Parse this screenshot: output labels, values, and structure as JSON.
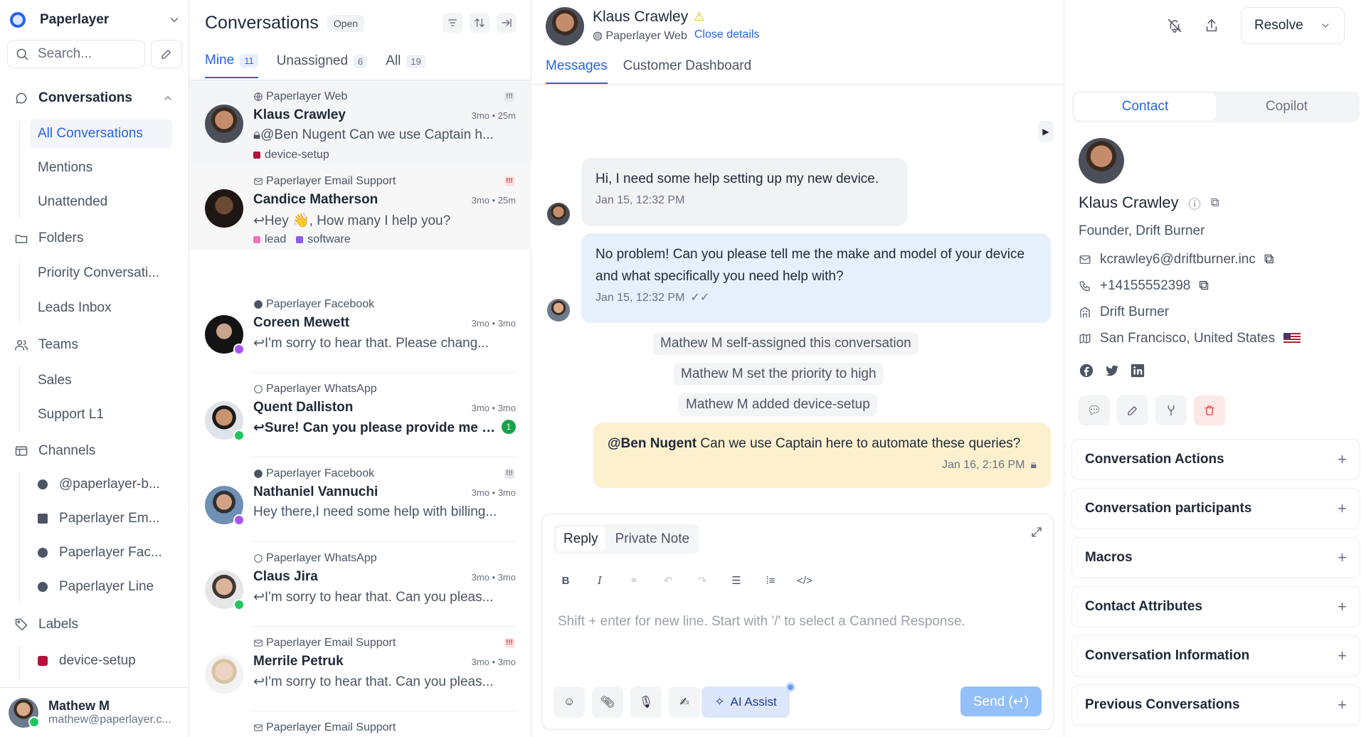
{
  "sidebar": {
    "workspace": "Paperlayer",
    "search_placeholder": "Search...",
    "groups": {
      "conversations": "Conversations",
      "folders": "Folders",
      "teams": "Teams",
      "channels": "Channels",
      "labels": "Labels"
    },
    "conversation_items": [
      "All Conversations",
      "Mentions",
      "Unattended"
    ],
    "folder_items": [
      "Priority Conversati...",
      "Leads Inbox"
    ],
    "team_items": [
      "Sales",
      "Support L1"
    ],
    "channel_items": [
      "@paperlayer-b...",
      "Paperlayer Em...",
      "Paperlayer Fac...",
      "Paperlayer Line"
    ],
    "label_items": [
      "device-setup"
    ],
    "user": {
      "name": "Mathew M",
      "email": "mathew@paperlayer.c..."
    }
  },
  "list": {
    "title": "Conversations",
    "status": "Open",
    "tabs": [
      {
        "label": "Mine",
        "count": "11"
      },
      {
        "label": "Unassigned",
        "count": "6"
      },
      {
        "label": "All",
        "count": "19"
      }
    ],
    "items": [
      {
        "channel": "Paperlayer Web",
        "name": "Klaus Crawley",
        "time": "3mo • 25m",
        "message": "@Ben Nugent Can we use Captain h...",
        "labels": [
          "device-setup"
        ]
      },
      {
        "channel": "Paperlayer Email Support",
        "name": "Candice Matherson",
        "time": "3mo • 25m",
        "message": "Hey 👋, How many I help you?",
        "labels": [
          "lead",
          "software"
        ]
      },
      {
        "channel": "Paperlayer Facebook",
        "name": "Coreen Mewett",
        "time": "3mo • 3mo",
        "message": "I'm sorry to hear that. Please chang..."
      },
      {
        "channel": "Paperlayer WhatsApp",
        "name": "Quent Dalliston",
        "time": "3mo • 3mo",
        "message": "Sure! Can you please provide me wi...",
        "unread": "1"
      },
      {
        "channel": "Paperlayer Facebook",
        "name": "Nathaniel Vannuchi",
        "time": "3mo • 3mo",
        "message": "Hey there,I need some help with billing..."
      },
      {
        "channel": "Paperlayer WhatsApp",
        "name": "Claus Jira",
        "time": "3mo • 3mo",
        "message": "I'm sorry to hear that. Can you pleas..."
      },
      {
        "channel": "Paperlayer Email Support",
        "name": "Merrile Petruk",
        "time": "3mo • 3mo",
        "message": "I'm sorry to hear that. Can you pleas..."
      },
      {
        "channel": "Paperlayer Email Support"
      }
    ]
  },
  "main": {
    "contact_name": "Klaus Crawley",
    "inbox": "Paperlayer Web",
    "close_details": "Close details",
    "tabs": [
      "Messages",
      "Customer Dashboard"
    ],
    "messages": [
      {
        "text": "Hi, I need some help setting up my new device.",
        "time": "Jan 15, 12:32 PM"
      },
      {
        "text": "No problem! Can you please tell me the make and model of your device and what specifically you need help with?",
        "time": "Jan 15, 12:32 PM"
      }
    ],
    "activities": [
      "Mathew M self-assigned this conversation",
      "Mathew M set the priority to high",
      "Mathew M added device-setup"
    ],
    "private_note": {
      "mention": "@Ben Nugent",
      "text": " Can we use Captain here to automate these queries?",
      "time": "Jan 16, 2:16 PM"
    },
    "reply": {
      "tabs": [
        "Reply",
        "Private Note"
      ],
      "placeholder": "Shift + enter for new line. Start with '/' to select a Canned Response.",
      "ai_assist": "AI Assist",
      "send": "Send (↵)"
    }
  },
  "header": {
    "resolve": "Resolve"
  },
  "contact": {
    "tabs": [
      "Contact",
      "Copilot"
    ],
    "name": "Klaus Crawley",
    "role": "Founder, Drift Burner",
    "email": "kcrawley6@driftburner.inc",
    "phone": "+14155552398",
    "company": "Drift Burner",
    "location": "San Francisco, United States"
  },
  "accordions": [
    "Conversation Actions",
    "Conversation participants",
    "Macros",
    "Contact Attributes",
    "Conversation Information",
    "Previous Conversations"
  ],
  "colors": {
    "accent": "#2563eb",
    "note_bg": "#fcf0cf",
    "outgoing_bg": "#e6effc",
    "label_device_setup": "#b3123c",
    "label_lead": "#f472b6",
    "label_software": "#8b5cf6"
  }
}
